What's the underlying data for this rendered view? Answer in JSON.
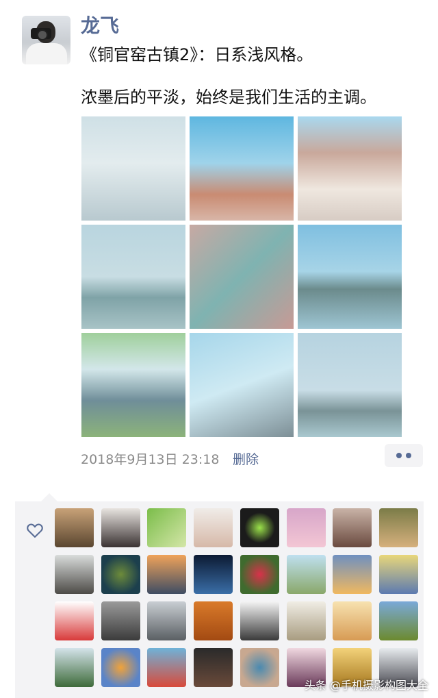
{
  "post": {
    "username": "龙飞",
    "line1": "《铜官窑古镇2》：日系浅风格。",
    "line2": "浓墨后的平淡，始终是我们生活的主调。",
    "timestamp": "2018年9月13日 23:18",
    "delete_label": "删除"
  },
  "photos": [
    {
      "name": "photo-arch-gate",
      "bg": "linear-gradient(180deg,#cfe0e6 0%,#e3ecee 45%,#b8c9cf 100%)"
    },
    {
      "name": "photo-pottery-jar",
      "bg": "linear-gradient(180deg,#5fb7e0 0%,#9fd3ea 45%,#c98b72 75%,#d8b6a8 100%)"
    },
    {
      "name": "photo-ancient-building",
      "bg": "linear-gradient(180deg,#a9d8ef 0%,#c9a89b 35%,#efe7df 70%,#d7ccc4 100%)"
    },
    {
      "name": "photo-pagoda-willow",
      "bg": "linear-gradient(180deg,#b9d5df 0%,#c8dde3 50%,#7fa3a7 70%,#a8c3c6 100%)"
    },
    {
      "name": "photo-signboard",
      "bg": "linear-gradient(135deg,#c7a9a3 0%,#7fb3b1 50%,#c79a95 100%)"
    },
    {
      "name": "photo-pagoda-lake",
      "bg": "linear-gradient(180deg,#7fbfe0 0%,#a7d4e7 45%,#6b8b8c 62%,#9ec5d3 100%)"
    },
    {
      "name": "photo-wall-sign",
      "bg": "linear-gradient(180deg,#9fcf9b 0%,#d3e7ea 35%,#6f8e99 65%,#8cb37a 100%)"
    },
    {
      "name": "photo-eaves",
      "bg": "linear-gradient(160deg,#a6d6ea 0%,#cfeaf3 50%,#7d8f96 100%)"
    },
    {
      "name": "photo-pagoda-distant",
      "bg": "linear-gradient(180deg,#b6d3e0 0%,#c8dde6 55%,#7a9397 75%,#a9c8cf 100%)"
    }
  ],
  "likes": {
    "heart_icon": "heart-outline-icon",
    "avatars": [
      {
        "name": "like-avatar-1",
        "bg": "linear-gradient(180deg,#c8a278,#5a4630)"
      },
      {
        "name": "like-avatar-2",
        "bg": "linear-gradient(180deg,#e8e4e0,#3a3232)"
      },
      {
        "name": "like-avatar-3",
        "bg": "linear-gradient(135deg,#7bbd4a,#d4e6a8)"
      },
      {
        "name": "like-avatar-4",
        "bg": "linear-gradient(180deg,#f0ece8,#d6b8a8)"
      },
      {
        "name": "like-avatar-5",
        "bg": "radial-gradient(circle,#9be24a 0%,#1b1b1b 55%)"
      },
      {
        "name": "like-avatar-6",
        "bg": "linear-gradient(180deg,#d7a6c9,#f3c6d4)"
      },
      {
        "name": "like-avatar-7",
        "bg": "linear-gradient(180deg,#c9b3a7,#6a4a3f)"
      },
      {
        "name": "like-avatar-8",
        "bg": "linear-gradient(180deg,#7b7c48,#d6b07d)"
      },
      {
        "name": "like-avatar-9",
        "bg": "linear-gradient(180deg,#d9dcdb,#4d4b47)"
      },
      {
        "name": "like-avatar-10",
        "bg": "radial-gradient(circle,#6d8b3a 0%,#1c3f4d 70%)"
      },
      {
        "name": "like-avatar-11",
        "bg": "linear-gradient(180deg,#f0a35a,#3f4d63)"
      },
      {
        "name": "like-avatar-12",
        "bg": "linear-gradient(180deg,#0c1a33,#3a6ea7)"
      },
      {
        "name": "like-avatar-13",
        "bg": "radial-gradient(circle,#d8324a 0%,#3f6b2e 70%)"
      },
      {
        "name": "like-avatar-14",
        "bg": "linear-gradient(180deg,#bfe0f0,#8aa86a)"
      },
      {
        "name": "like-avatar-15",
        "bg": "linear-gradient(180deg,#6f90c0,#f0b860)"
      },
      {
        "name": "like-avatar-16",
        "bg": "linear-gradient(180deg,#e9d77a,#5c7ab0)"
      },
      {
        "name": "like-avatar-17",
        "bg": "linear-gradient(180deg,#ffffff,#d83a3a)"
      },
      {
        "name": "like-avatar-18",
        "bg": "linear-gradient(180deg,#9a9a9a,#3b3b3b)"
      },
      {
        "name": "like-avatar-19",
        "bg": "linear-gradient(180deg,#c9ced3,#5a5f63)"
      },
      {
        "name": "like-avatar-20",
        "bg": "linear-gradient(180deg,#d97a2a,#a34a12)"
      },
      {
        "name": "like-avatar-21",
        "bg": "linear-gradient(180deg,#f4f4f4,#3a3a3a)"
      },
      {
        "name": "like-avatar-22",
        "bg": "linear-gradient(180deg,#f0ede5,#a89c80)"
      },
      {
        "name": "like-avatar-23",
        "bg": "linear-gradient(180deg,#f7e2b0,#d79b54)"
      },
      {
        "name": "like-avatar-24",
        "bg": "linear-gradient(180deg,#7aa9d8,#6c8a2e)"
      },
      {
        "name": "like-avatar-25",
        "bg": "linear-gradient(180deg,#d4e3ea,#3e6b3a)"
      },
      {
        "name": "like-avatar-26",
        "bg": "radial-gradient(circle,#f0a23a 0%,#5a84c8 70%)"
      },
      {
        "name": "like-avatar-27",
        "bg": "linear-gradient(180deg,#6fb2d8,#d84a3a)"
      },
      {
        "name": "like-avatar-28",
        "bg": "linear-gradient(180deg,#2a2a2a,#6a4a3a)"
      },
      {
        "name": "like-avatar-29",
        "bg": "radial-gradient(circle,#4a8ab0 0%,#c8a890 70%)"
      },
      {
        "name": "like-avatar-30",
        "bg": "linear-gradient(180deg,#f0d8e0,#6a3a5a)"
      },
      {
        "name": "like-avatar-31",
        "bg": "linear-gradient(180deg,#f3d27a,#a6781f)"
      },
      {
        "name": "like-avatar-32",
        "bg": "linear-gradient(180deg,#e7ebee,#4a4a52)"
      }
    ]
  },
  "footer": {
    "text": "头条 @手机摄影构图大全"
  }
}
